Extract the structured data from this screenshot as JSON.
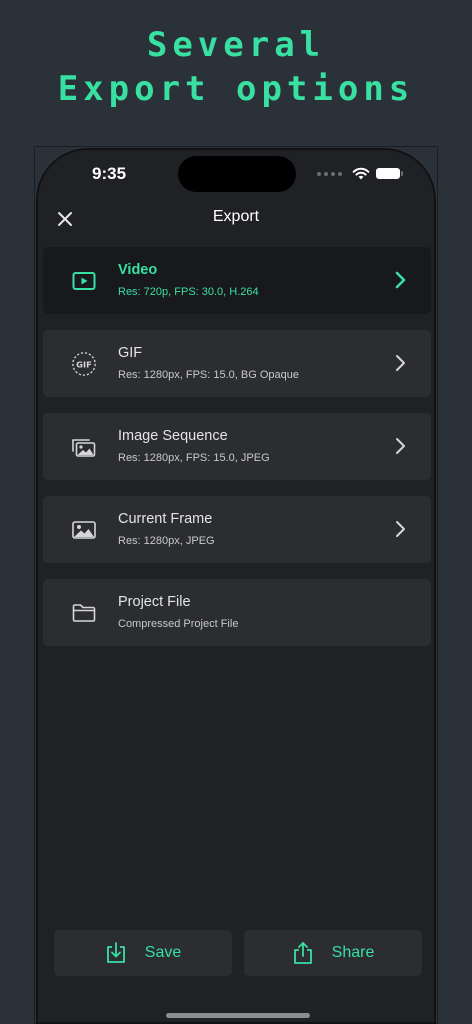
{
  "promo": {
    "line1": "Several",
    "line2": "Export options"
  },
  "status_bar": {
    "time": "9:35"
  },
  "nav": {
    "title": "Export",
    "close_icon": "close-icon"
  },
  "options": [
    {
      "title": "Video",
      "subtitle": "Res: 720p, FPS: 30.0, H.264",
      "icon": "video-icon",
      "selected": true
    },
    {
      "title": "GIF",
      "subtitle": "Res: 1280px, FPS: 15.0, BG Opaque",
      "icon": "gif-icon",
      "selected": false
    },
    {
      "title": "Image Sequence",
      "subtitle": "Res: 1280px, FPS: 15.0, JPEG",
      "icon": "image-sequence-icon",
      "selected": false
    },
    {
      "title": "Current Frame",
      "subtitle": "Res: 1280px, JPEG",
      "icon": "image-icon",
      "selected": false
    },
    {
      "title": "Project File",
      "subtitle": "Compressed Project File",
      "icon": "folder-icon",
      "selected": false
    }
  ],
  "actions": {
    "save_label": "Save",
    "share_label": "Share"
  },
  "colors": {
    "accent": "#38e0a2",
    "background": "#2b3138",
    "screen": "#202124",
    "card": "#2b2d31",
    "selected_card": "#18191c"
  }
}
